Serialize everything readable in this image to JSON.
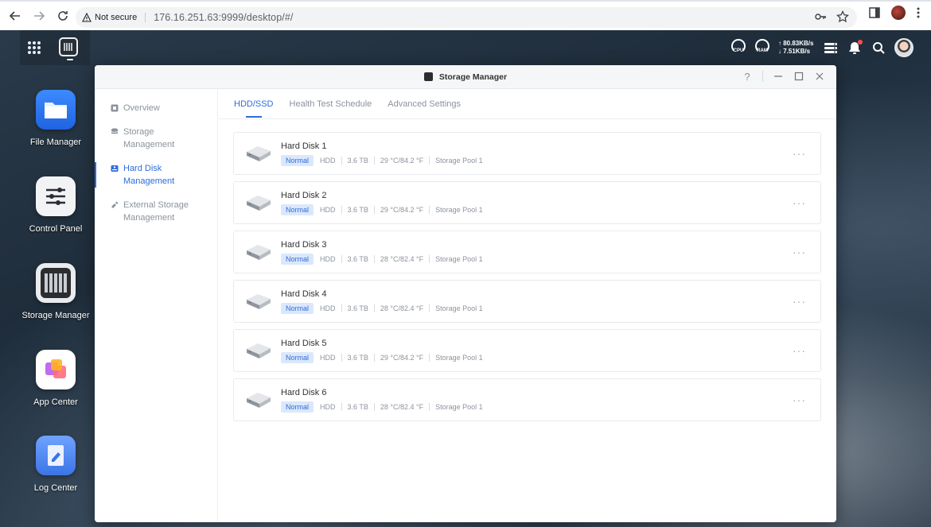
{
  "browser": {
    "security_label": "Not secure",
    "url": "176.16.251.63:9999/desktop/#/"
  },
  "tray": {
    "cpu_label": "CPU",
    "ram_label": "RAM",
    "upload_speed": "↑ 80.83KB/s",
    "download_speed": "↓ 7.51KB/s"
  },
  "desktop_icons": [
    {
      "label": "File Manager"
    },
    {
      "label": "Control Panel"
    },
    {
      "label": "Storage Manager"
    },
    {
      "label": "App Center"
    },
    {
      "label": "Log Center"
    }
  ],
  "window": {
    "title": "Storage Manager",
    "help": "?"
  },
  "sidebar": {
    "items": [
      {
        "label": "Overview"
      },
      {
        "label": "Storage Management"
      },
      {
        "label": "Hard Disk Management"
      },
      {
        "label": "External Storage Management"
      }
    ]
  },
  "tabs": [
    {
      "label": "HDD/SSD"
    },
    {
      "label": "Health Test Schedule"
    },
    {
      "label": "Advanced Settings"
    }
  ],
  "disks": [
    {
      "name": "Hard Disk 1",
      "status": "Normal",
      "type": "HDD",
      "capacity": "3.6 TB",
      "temp": "29 °C/84.2 °F",
      "pool": "Storage Pool 1"
    },
    {
      "name": "Hard Disk 2",
      "status": "Normal",
      "type": "HDD",
      "capacity": "3.6 TB",
      "temp": "29 °C/84.2 °F",
      "pool": "Storage Pool 1"
    },
    {
      "name": "Hard Disk 3",
      "status": "Normal",
      "type": "HDD",
      "capacity": "3.6 TB",
      "temp": "28 °C/82.4 °F",
      "pool": "Storage Pool 1"
    },
    {
      "name": "Hard Disk 4",
      "status": "Normal",
      "type": "HDD",
      "capacity": "3.6 TB",
      "temp": "28 °C/82.4 °F",
      "pool": "Storage Pool 1"
    },
    {
      "name": "Hard Disk 5",
      "status": "Normal",
      "type": "HDD",
      "capacity": "3.6 TB",
      "temp": "29 °C/84.2 °F",
      "pool": "Storage Pool 1"
    },
    {
      "name": "Hard Disk 6",
      "status": "Normal",
      "type": "HDD",
      "capacity": "3.6 TB",
      "temp": "28 °C/82.4 °F",
      "pool": "Storage Pool 1"
    }
  ],
  "more_glyph": "···",
  "colors": {
    "accent": "#2f6bdc",
    "badge_bg": "#dbe8fb"
  }
}
